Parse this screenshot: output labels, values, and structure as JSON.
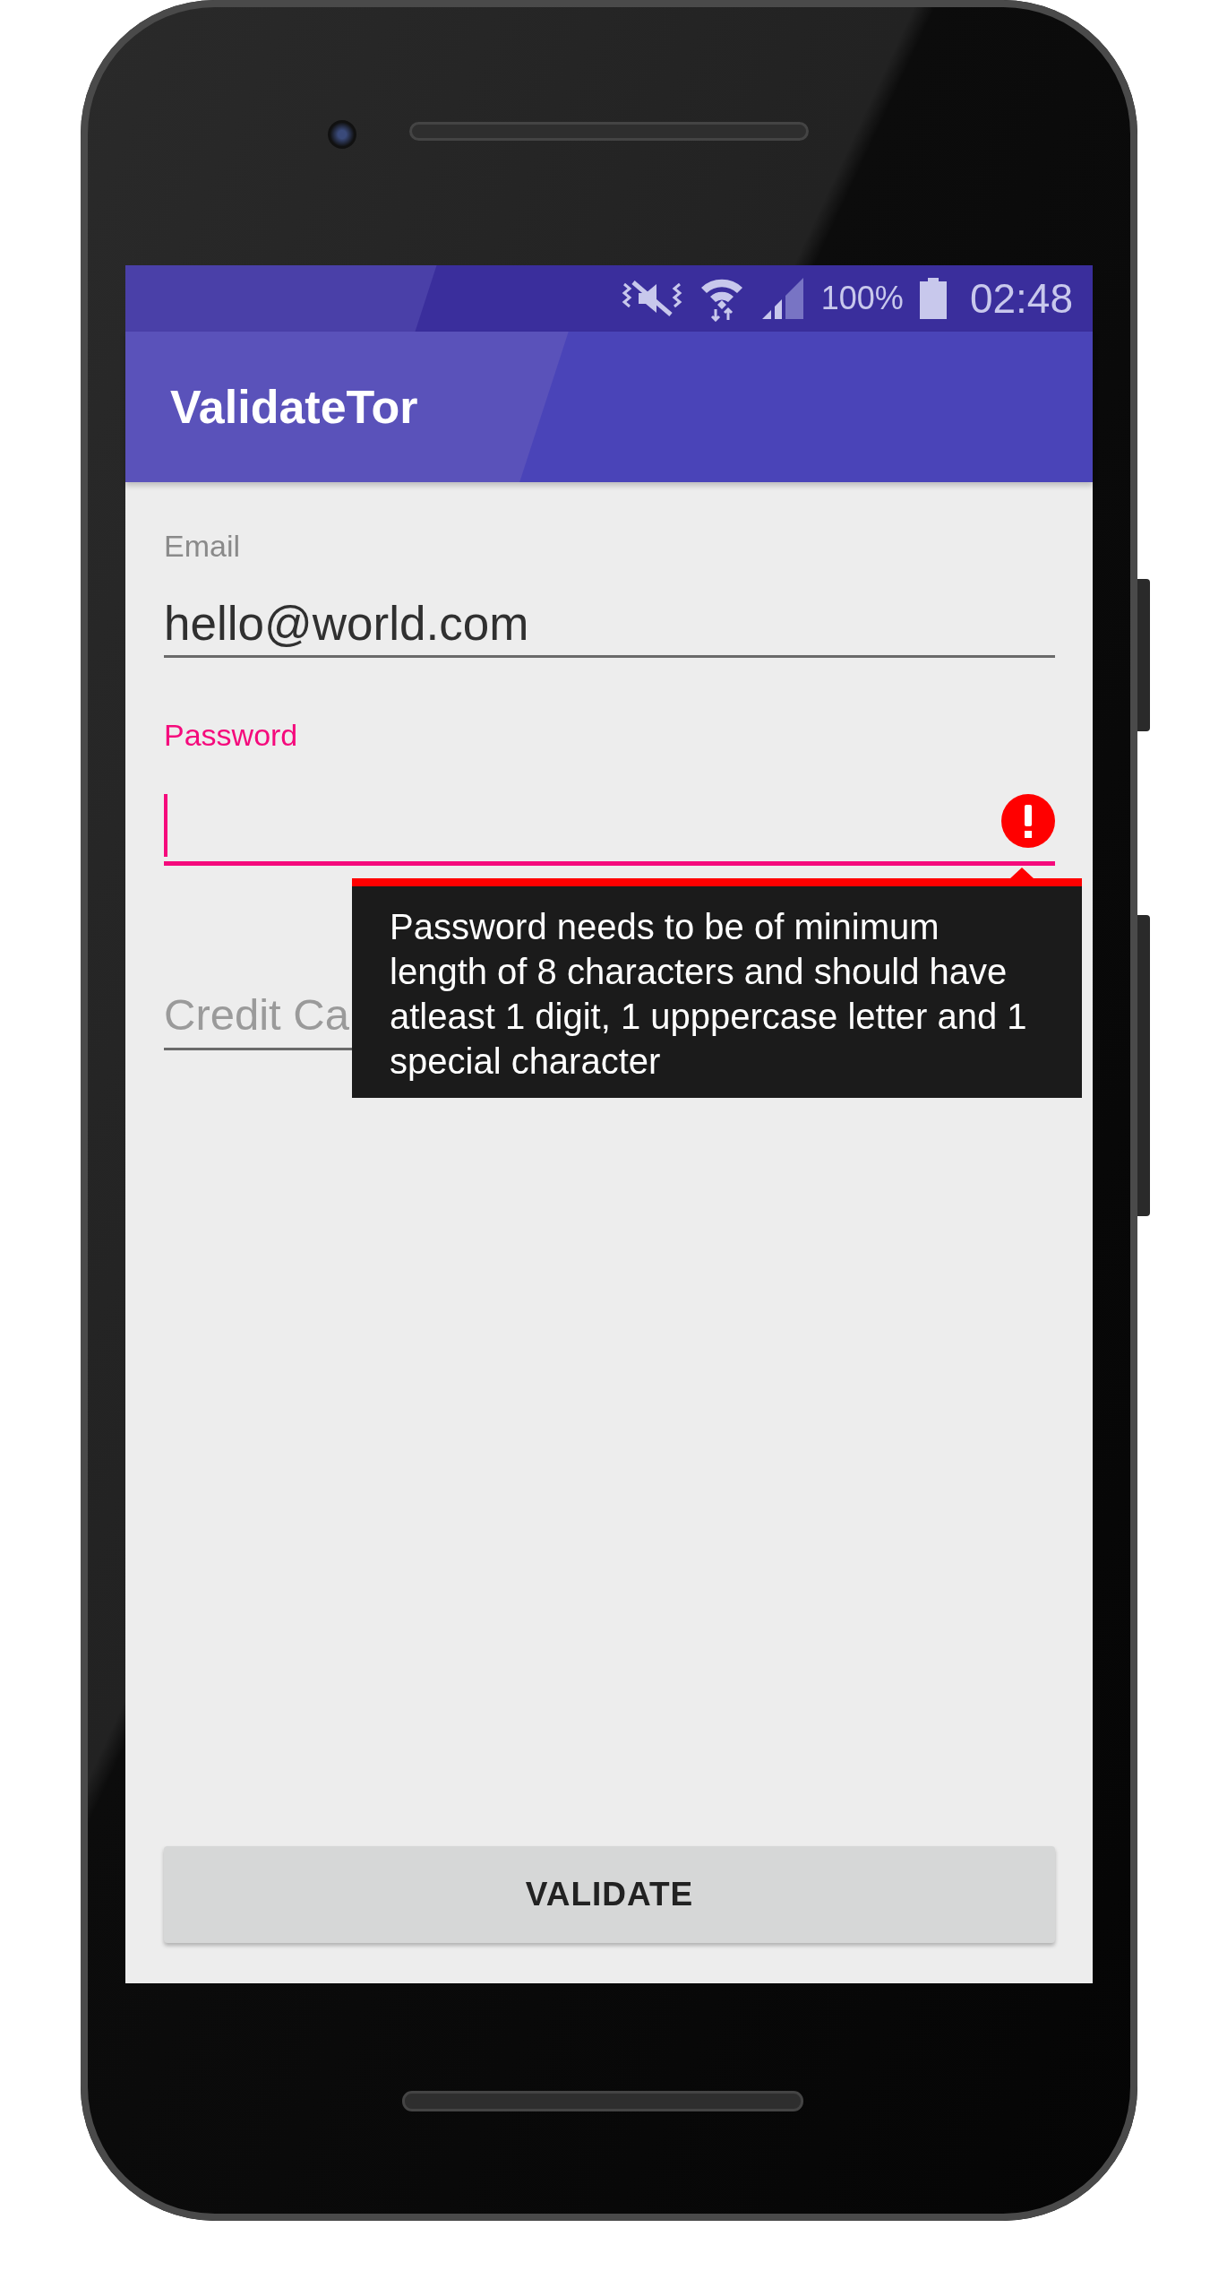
{
  "status_bar": {
    "battery": "100%",
    "time": "02:48"
  },
  "app_bar": {
    "title": "ValidateTor"
  },
  "fields": [
    {
      "label": "Email",
      "value": "hello@world.com",
      "focused": false,
      "error": false
    },
    {
      "label": "Password",
      "focused": true,
      "error": true
    },
    {
      "placeholder": "Credit Ca",
      "focused": false,
      "error": false
    }
  ],
  "error_tooltip": {
    "text": "Password needs to be of minimum length of 8 characters and should have atleast 1 digit, 1 upppercase letter and 1 special character"
  },
  "button": {
    "label": "VALIDATE"
  }
}
